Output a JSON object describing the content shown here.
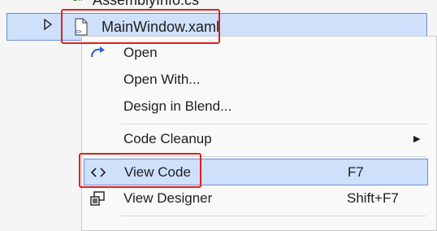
{
  "top_row": {
    "label": "AssemblyInfo.cs",
    "icon": "csharp-file-icon"
  },
  "tree": {
    "selected_item": {
      "label": "MainWindow.xaml",
      "icon": "xaml-file-icon",
      "expander_icon": "expand-triangle-icon"
    }
  },
  "context_menu": {
    "items": [
      {
        "label": "Open",
        "icon": "open-arrow-icon"
      },
      {
        "label": "Open With..."
      },
      {
        "label": "Design in Blend..."
      },
      {
        "label": "Code Cleanup",
        "has_submenu": true
      },
      {
        "label": "View Code",
        "shortcut": "F7",
        "icon": "code-brackets-icon",
        "selected": true
      },
      {
        "label": "View Designer",
        "shortcut": "Shift+F7",
        "icon": "view-designer-icon"
      }
    ]
  },
  "colors": {
    "selection_background": "#cfe0fb",
    "selection_border": "#6c8ed8",
    "highlight_red": "#e0201b",
    "menu_background": "#f9f9f9"
  }
}
